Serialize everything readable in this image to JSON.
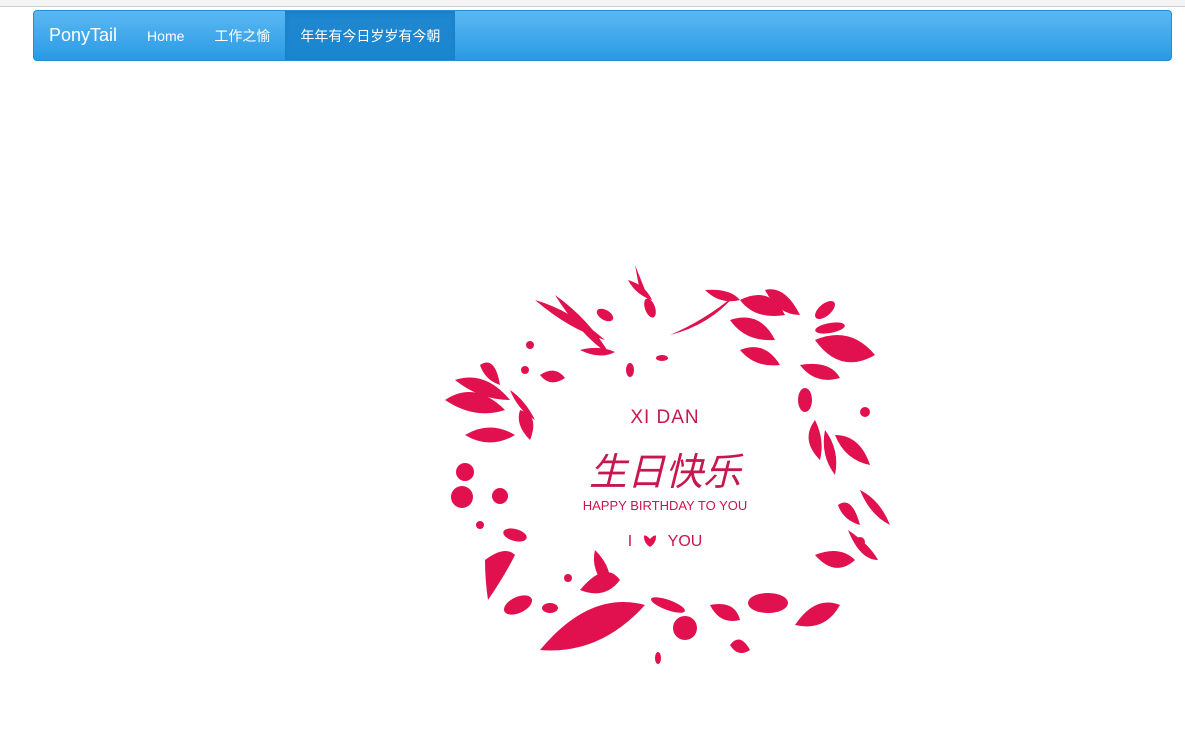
{
  "navbar": {
    "brand": "PonyTail",
    "items": [
      {
        "label": "Home",
        "active": false
      },
      {
        "label": "工作之愉",
        "active": false
      },
      {
        "label": "年年有今日岁岁有今朝",
        "active": true
      }
    ]
  },
  "card": {
    "name": "XI DAN",
    "title": "生日快乐",
    "subtitle": "HAPPY BIRTHDAY TO YOU",
    "love_left": "I",
    "love_right": "YOU",
    "accent_color": "#e0114e"
  }
}
